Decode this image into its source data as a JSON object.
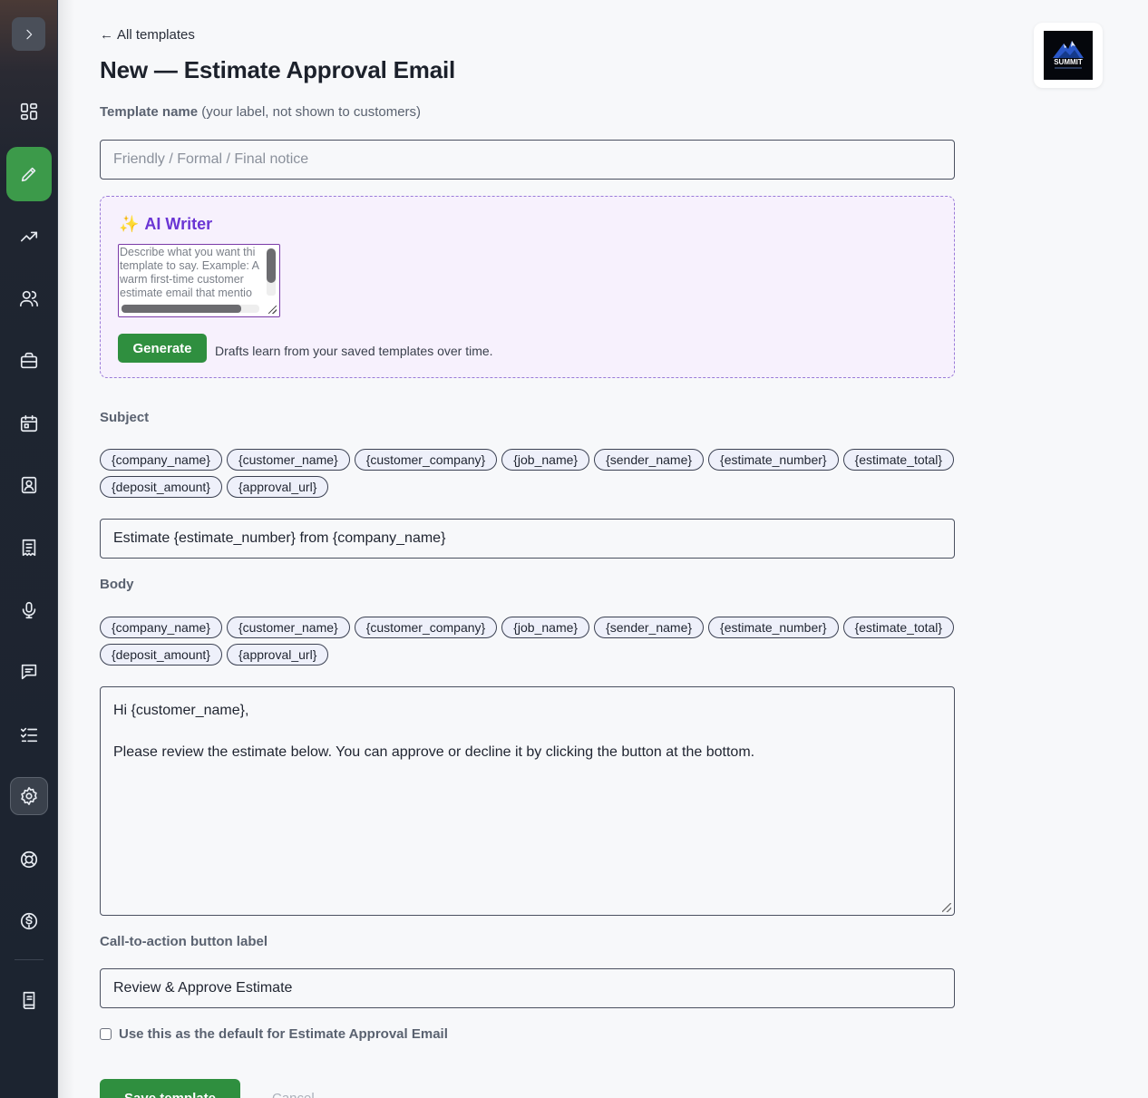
{
  "nav": {
    "back_label": "All templates",
    "page_title": "New — Estimate Approval Email"
  },
  "template_name": {
    "label": "Template name",
    "note": "(your label, not shown to customers)",
    "placeholder": "Friendly / Formal / Final notice"
  },
  "ai_writer": {
    "title": "AI Writer",
    "placeholder": "Describe what you want thi\ntemplate to say. Example: A\nwarm first-time customer\nestimate email that mentio",
    "generate_label": "Generate",
    "help_text": "Drafts learn from your saved templates over time."
  },
  "subject": {
    "label": "Subject",
    "value": "Estimate {estimate_number} from {company_name}"
  },
  "body": {
    "label": "Body",
    "lines": [
      "Hi {customer_name},",
      "",
      "Please review the estimate below. You can approve or decline it by clicking the button at the bottom."
    ]
  },
  "variables": [
    "{company_name}",
    "{customer_name}",
    "{customer_company}",
    "{job_name}",
    "{sender_name}",
    "{estimate_number}",
    "{estimate_total}",
    "{deposit_amount}",
    "{approval_url}"
  ],
  "cta": {
    "label": "Call-to-action button label",
    "value": "Review & Approve Estimate"
  },
  "default_checkbox": {
    "label": "Use this as the default for Estimate Approval Email",
    "checked": false
  },
  "actions": {
    "save_label": "Save template",
    "cancel_label": "Cancel"
  },
  "logo": {
    "text": "SUMMIT"
  },
  "colors": {
    "accent_green": "#2f8f3f",
    "ai_purple": "#6a35d4",
    "sidebar_bg": "#1c2430"
  }
}
